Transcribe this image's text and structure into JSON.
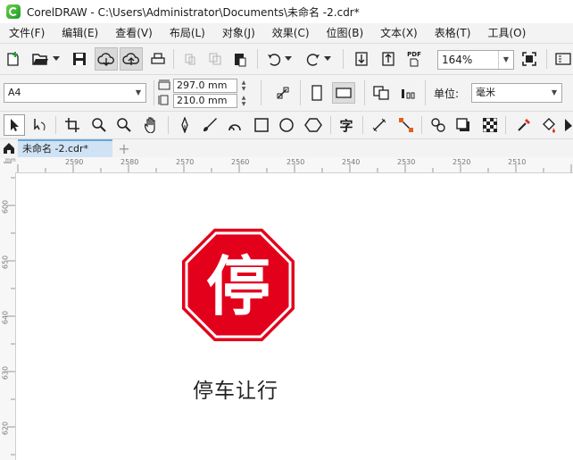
{
  "window": {
    "title": "CorelDRAW - C:\\Users\\Administrator\\Documents\\未命名 -2.cdr*"
  },
  "menu": {
    "items": [
      "文件(F)",
      "编辑(E)",
      "查看(V)",
      "布局(L)",
      "对象(J)",
      "效果(C)",
      "位图(B)",
      "文本(X)",
      "表格(T)",
      "工具(O)"
    ]
  },
  "toolbar": {
    "zoom_value": "164%",
    "pdf_label": "PDF"
  },
  "property_bar": {
    "page_size": "A4",
    "width": "297.0 mm",
    "height": "210.0 mm",
    "units_label": "单位:",
    "units_value": "毫米"
  },
  "tabs": {
    "document": "未命名 -2.cdr*",
    "add": "+"
  },
  "ruler": {
    "h_ticks": [
      "2590",
      "2580",
      "2570",
      "2560",
      "2550",
      "2540",
      "2530",
      "2520",
      "2510"
    ],
    "v_ticks": [
      "600",
      "650",
      "640",
      "630",
      "620"
    ]
  },
  "canvas": {
    "sign_char": "停",
    "caption": "停车让行",
    "sign_color": "#e3001b"
  }
}
